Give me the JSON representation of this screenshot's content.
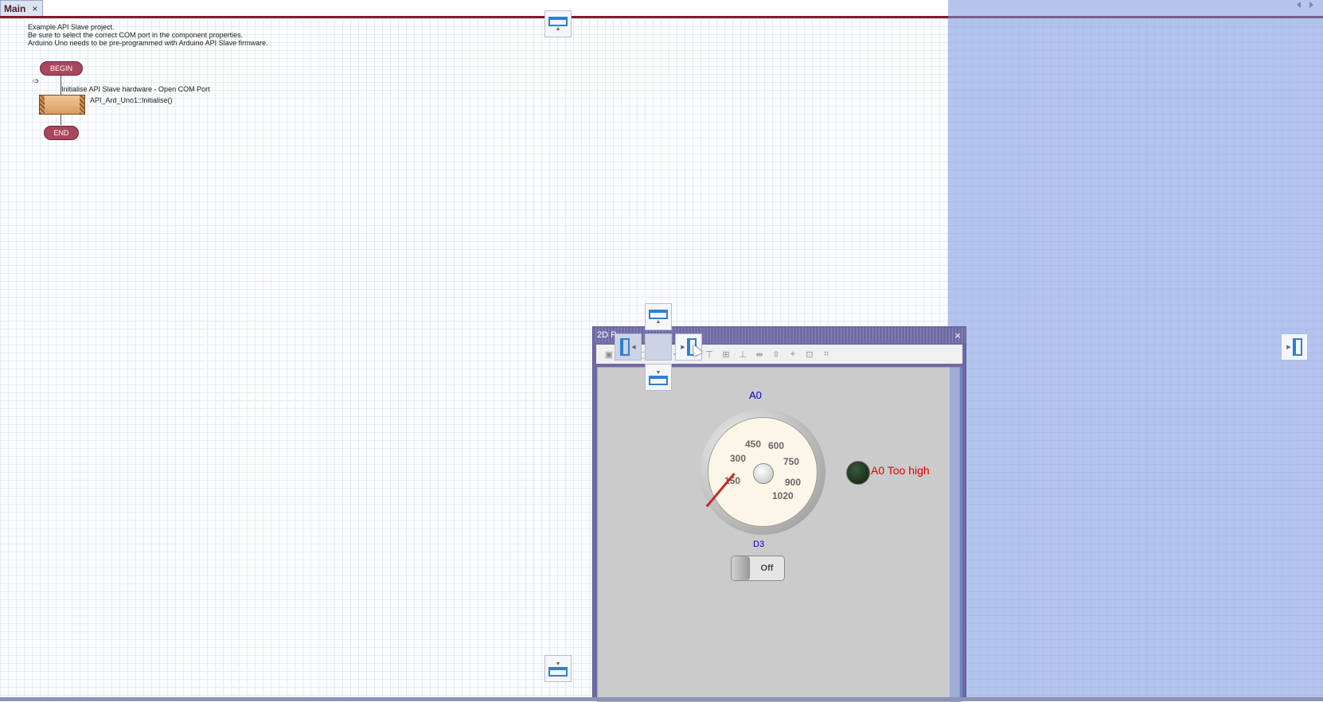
{
  "tabs": {
    "main_label": "Main",
    "close_glyph": "×"
  },
  "flowchart": {
    "comment_lines": [
      "Example API Slave project.",
      "Be sure to select the correct COM port in the component properties.",
      "Arduino Uno needs to be pre-programmed with Arduino API Slave firmware."
    ],
    "begin_label": "BEGIN",
    "end_label": "END",
    "macro_comment": "Initialise API Slave hardware - Open COM Port",
    "macro_call": "API_Ard_Uno1::Initialise()"
  },
  "panel": {
    "title": "2D P",
    "close_glyph": "×",
    "gauge": {
      "label": "A0",
      "scale_labels": [
        "150",
        "300",
        "450",
        "600",
        "750",
        "900",
        "1020"
      ],
      "needle_value": 0,
      "min": 0,
      "max": 1020
    },
    "led_label": "A0 Too high",
    "switch_label": "D3",
    "switch_state": "Off"
  },
  "dock_icons": [
    "dock-top-icon",
    "dock-bottom-icon",
    "dock-left-icon",
    "dock-right-icon",
    "dock-center-icon"
  ],
  "colors": {
    "tab_border": "#7b1f2a",
    "terminal": "#a8465c",
    "panel_frame": "#6f6aa4",
    "gauge_label": "#0000cc",
    "led_label": "#e00000"
  }
}
